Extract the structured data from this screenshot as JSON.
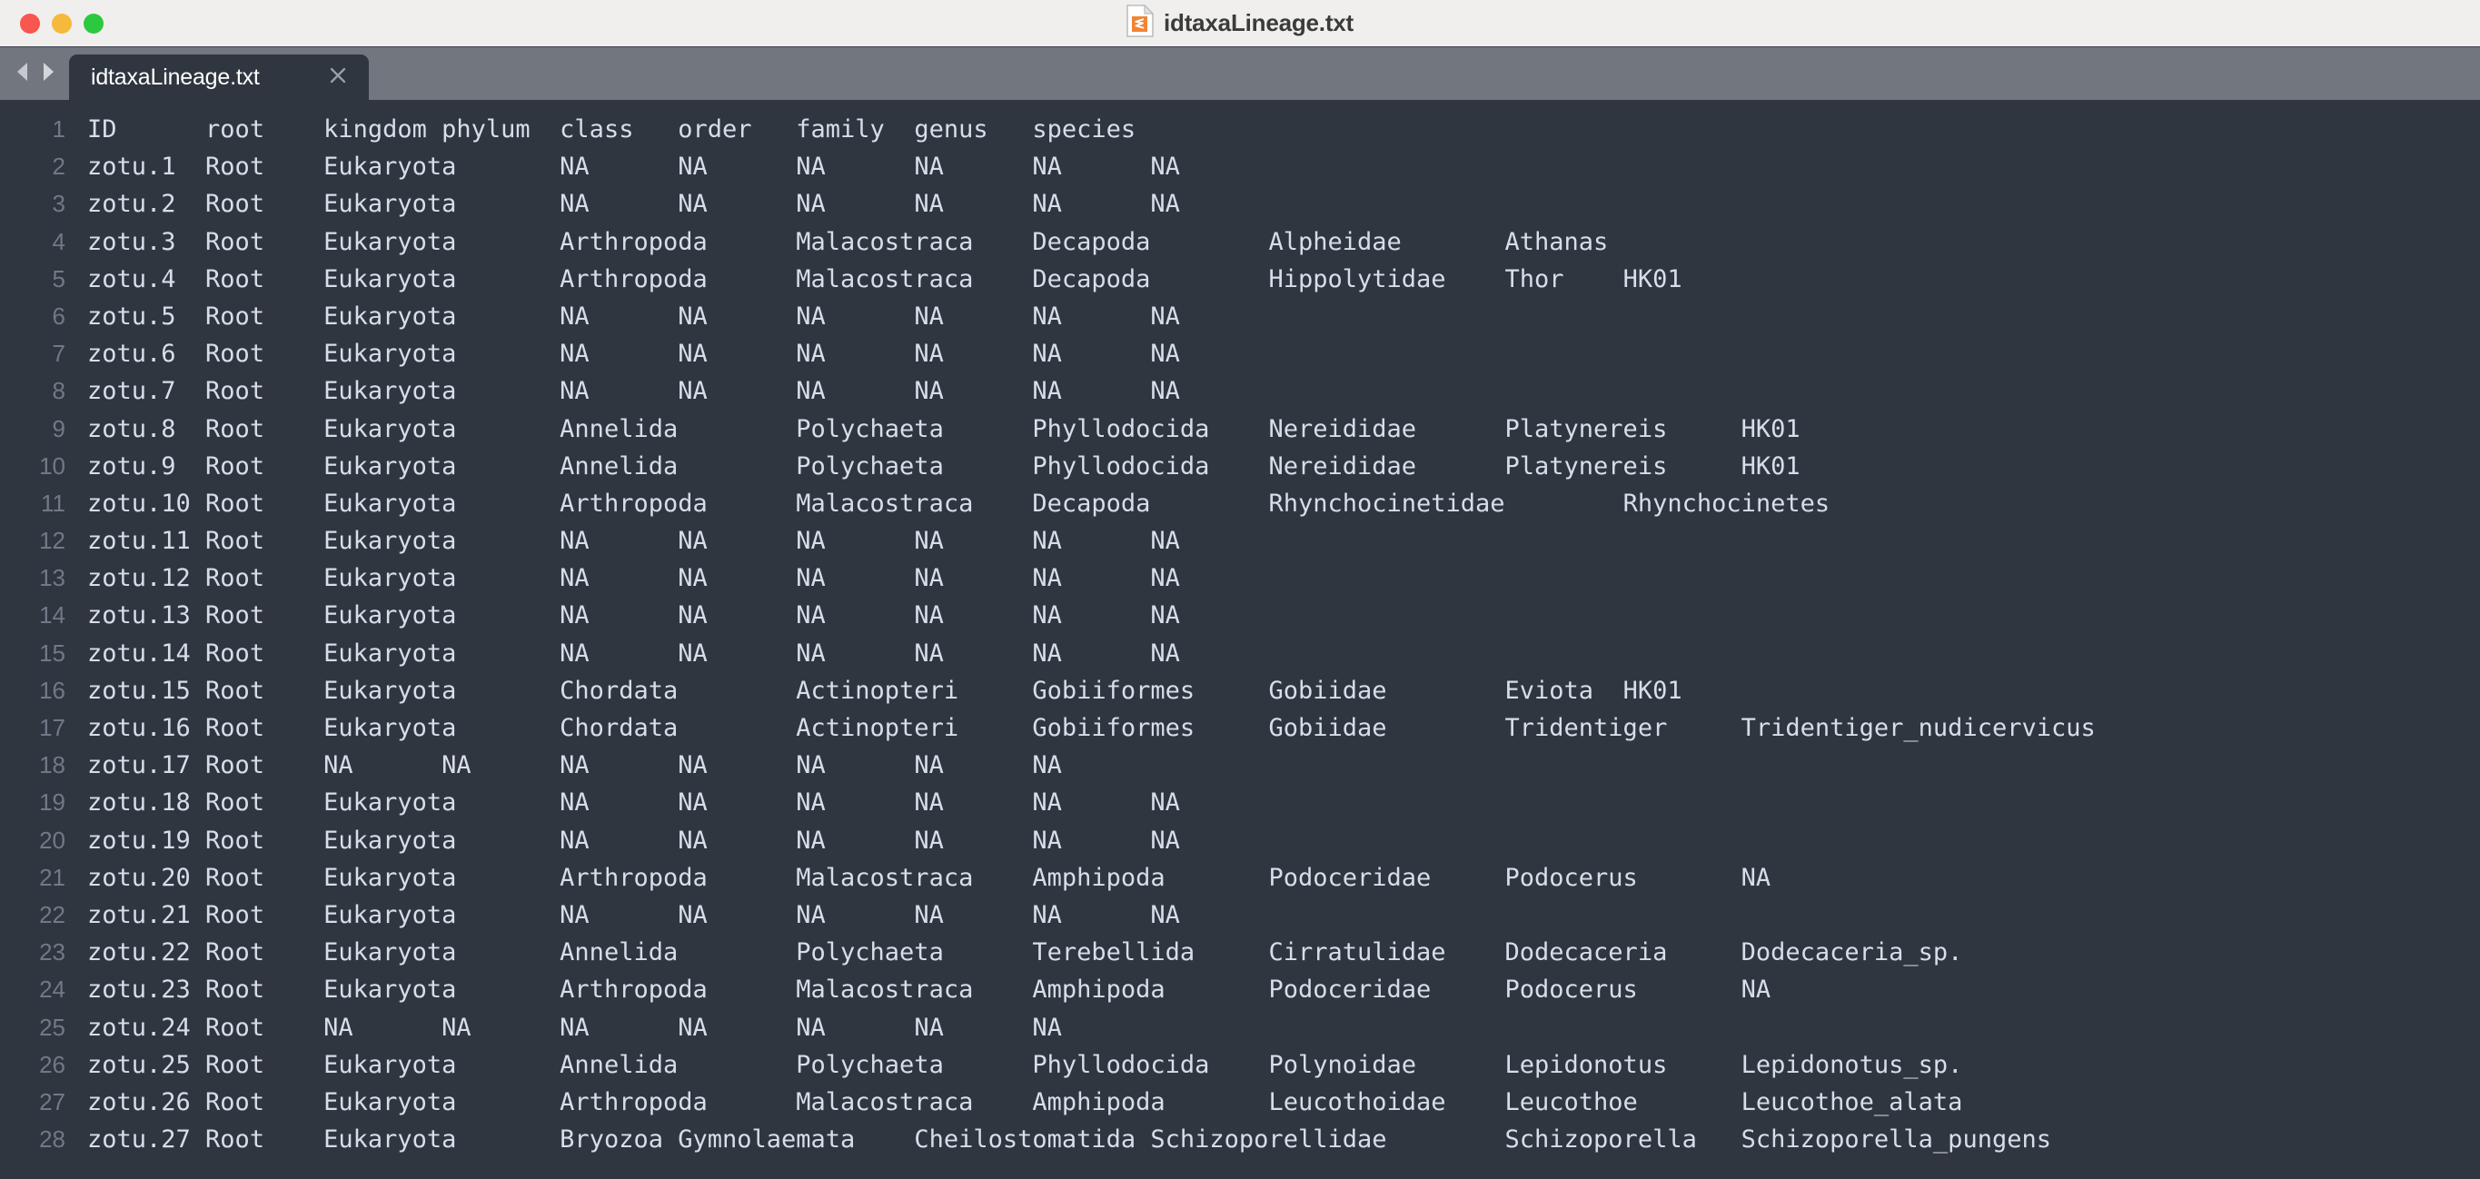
{
  "window": {
    "title": "idtaxaLineage.txt",
    "doc_icon": "sublime-text-document-icon",
    "traffic_lights": [
      {
        "name": "close",
        "color": "#f9564f"
      },
      {
        "name": "minimize",
        "color": "#f5b93c"
      },
      {
        "name": "maximize",
        "color": "#2bc940"
      }
    ]
  },
  "tabbar": {
    "nav_back_icon": "nav-back-arrow-icon",
    "nav_forward_icon": "nav-forward-arrow-icon",
    "tabs": [
      {
        "label": "idtaxaLineage.txt",
        "active": true,
        "close_icon": "close-icon"
      }
    ]
  },
  "theme": {
    "titlebar_bg": "#f0efed",
    "tabbar_bg": "#72777f",
    "editor_bg": "#2f3640",
    "text_color": "#d8dee9",
    "gutter_color": "#707a87",
    "tab_active_bg": "#2f3640"
  },
  "editor": {
    "tab_size": 8,
    "line_numbers": [
      1,
      2,
      3,
      4,
      5,
      6,
      7,
      8,
      9,
      10,
      11,
      12,
      13,
      14,
      15,
      16,
      17,
      18,
      19,
      20,
      21,
      22,
      23,
      24,
      25,
      26,
      27,
      28
    ],
    "lines": [
      "ID\troot\tkingdom\tphylum\tclass\torder\tfamily\tgenus\tspecies",
      "zotu.1\tRoot\tEukaryota\tNA\tNA\tNA\tNA\tNA\tNA",
      "zotu.2\tRoot\tEukaryota\tNA\tNA\tNA\tNA\tNA\tNA",
      "zotu.3\tRoot\tEukaryota\tArthropoda\tMalacostraca\tDecapoda\tAlpheidae\tAthanas",
      "zotu.4\tRoot\tEukaryota\tArthropoda\tMalacostraca\tDecapoda\tHippolytidae\tThor\tHK01",
      "zotu.5\tRoot\tEukaryota\tNA\tNA\tNA\tNA\tNA\tNA",
      "zotu.6\tRoot\tEukaryota\tNA\tNA\tNA\tNA\tNA\tNA",
      "zotu.7\tRoot\tEukaryota\tNA\tNA\tNA\tNA\tNA\tNA",
      "zotu.8\tRoot\tEukaryota\tAnnelida\tPolychaeta\tPhyllodocida\tNereididae\tPlatynereis\tHK01",
      "zotu.9\tRoot\tEukaryota\tAnnelida\tPolychaeta\tPhyllodocida\tNereididae\tPlatynereis\tHK01",
      "zotu.10\tRoot\tEukaryota\tArthropoda\tMalacostraca\tDecapoda\tRhynchocinetidae\tRhynchocinetes",
      "zotu.11\tRoot\tEukaryota\tNA\tNA\tNA\tNA\tNA\tNA",
      "zotu.12\tRoot\tEukaryota\tNA\tNA\tNA\tNA\tNA\tNA",
      "zotu.13\tRoot\tEukaryota\tNA\tNA\tNA\tNA\tNA\tNA",
      "zotu.14\tRoot\tEukaryota\tNA\tNA\tNA\tNA\tNA\tNA",
      "zotu.15\tRoot\tEukaryota\tChordata\tActinopteri\tGobiiformes\tGobiidae\tEviota\tHK01",
      "zotu.16\tRoot\tEukaryota\tChordata\tActinopteri\tGobiiformes\tGobiidae\tTridentiger\tTridentiger_nudicervicus",
      "zotu.17\tRoot\tNA\tNA\tNA\tNA\tNA\tNA\tNA",
      "zotu.18\tRoot\tEukaryota\tNA\tNA\tNA\tNA\tNA\tNA",
      "zotu.19\tRoot\tEukaryota\tNA\tNA\tNA\tNA\tNA\tNA",
      "zotu.20\tRoot\tEukaryota\tArthropoda\tMalacostraca\tAmphipoda\tPodoceridae\tPodocerus\tNA",
      "zotu.21\tRoot\tEukaryota\tNA\tNA\tNA\tNA\tNA\tNA",
      "zotu.22\tRoot\tEukaryota\tAnnelida\tPolychaeta\tTerebellida\tCirratulidae\tDodecaceria\tDodecaceria_sp.",
      "zotu.23\tRoot\tEukaryota\tArthropoda\tMalacostraca\tAmphipoda\tPodoceridae\tPodocerus\tNA",
      "zotu.24\tRoot\tNA\tNA\tNA\tNA\tNA\tNA\tNA",
      "zotu.25\tRoot\tEukaryota\tAnnelida\tPolychaeta\tPhyllodocida\tPolynoidae\tLepidonotus\tLepidonotus_sp.",
      "zotu.26\tRoot\tEukaryota\tArthropoda\tMalacostraca\tAmphipoda\tLeucothoidae\tLeucothoe\tLeucothoe_alata",
      "zotu.27\tRoot\tEukaryota\tBryozoa\tGymnolaemata\tCheilostomatida\tSchizoporellidae\tSchizoporella\tSchizoporella_pungens"
    ]
  }
}
